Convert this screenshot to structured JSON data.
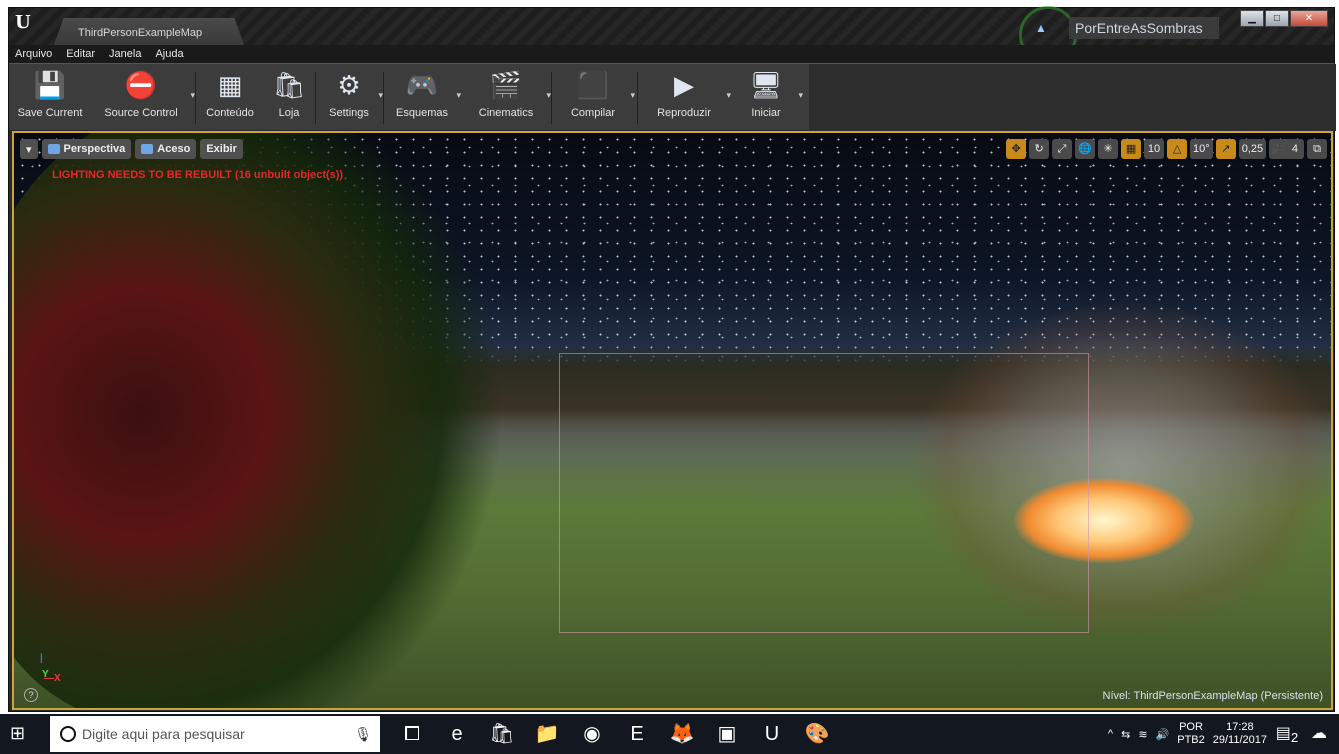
{
  "window": {
    "tab_title": "ThirdPersonExampleMap",
    "user": "PorEntreAsSombras"
  },
  "menu": [
    "Arquivo",
    "Editar",
    "Janela",
    "Ajuda"
  ],
  "toolbar": [
    {
      "label": "Save Current",
      "icon": "floppy-icon"
    },
    {
      "label": "Source Control",
      "icon": "source-control-icon"
    },
    {
      "label": "Conteúdo",
      "icon": "content-icon"
    },
    {
      "label": "Loja",
      "icon": "marketplace-icon"
    },
    {
      "label": "Settings",
      "icon": "settings-icon"
    },
    {
      "label": "Esquemas",
      "icon": "blueprints-icon"
    },
    {
      "label": "Cinematics",
      "icon": "cinematics-icon"
    },
    {
      "label": "Compilar",
      "icon": "build-icon"
    },
    {
      "label": "Reproduzir",
      "icon": "play-icon"
    },
    {
      "label": "Iniciar",
      "icon": "launch-icon"
    }
  ],
  "viewport": {
    "perspective": "Perspectiva",
    "lighting": "Aceso",
    "show": "Exibir",
    "warning": "LIGHTING NEEDS TO BE REBUILT (16 unbuilt object(s))",
    "grid_snap": "10",
    "rotation_snap": "10°",
    "scale_snap": "0,25",
    "camera_speed": "4",
    "level": "Nível:  ThirdPersonExampleMap (Persistente)"
  },
  "taskbar": {
    "search_placeholder": "Digite aqui para pesquisar",
    "lang_top": "POR",
    "lang_bottom": "PTB2",
    "time": "17:28",
    "date": "29/11/2017",
    "notifications": "2"
  }
}
